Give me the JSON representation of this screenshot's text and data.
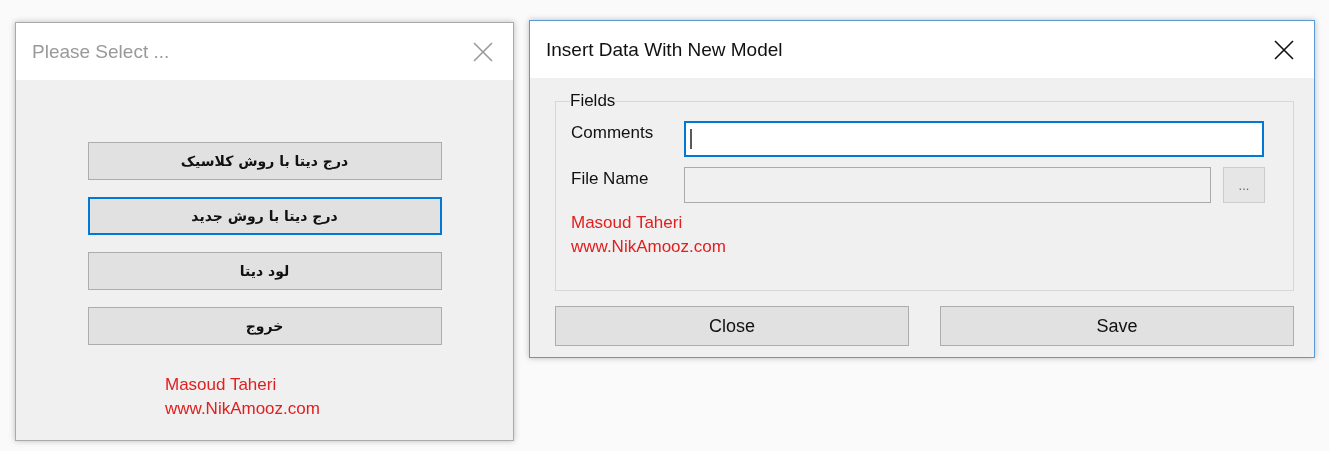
{
  "select_window": {
    "title": "Please Select ...",
    "active": false,
    "buttons": [
      {
        "label": "درج دیتا با روش کلاسیک",
        "focused": false
      },
      {
        "label": "درج دیتا با روش جدید",
        "focused": true
      },
      {
        "label": "لود دیتا",
        "focused": false
      },
      {
        "label": "خروج",
        "focused": false
      }
    ],
    "credit": [
      "Masoud Taheri",
      "www.NikAmooz.com"
    ]
  },
  "insert_window": {
    "title": "Insert Data With New Model",
    "active": true,
    "group": {
      "title": "Fields",
      "fields": [
        {
          "label": "Comments",
          "focused": true,
          "disabled": false,
          "browse": false
        },
        {
          "label": "File Name",
          "focused": false,
          "disabled": true,
          "browse": true,
          "browse_label": "..."
        }
      ],
      "credit": [
        "Masoud Taheri",
        "www.NikAmooz.com"
      ]
    },
    "buttons": [
      "Close",
      "Save"
    ]
  }
}
